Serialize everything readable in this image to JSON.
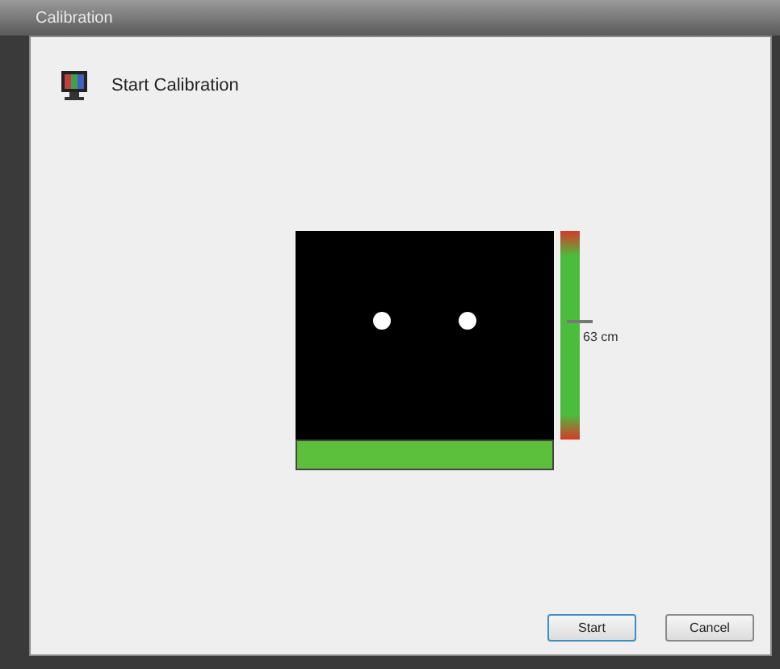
{
  "window": {
    "title": "Calibration"
  },
  "heading": "Start Calibration",
  "distance": {
    "level": 0.57,
    "reading": "63 cm"
  },
  "buttons": [
    {
      "label": "Start",
      "selected": true
    },
    {
      "label": "Cancel",
      "selected": false
    }
  ]
}
